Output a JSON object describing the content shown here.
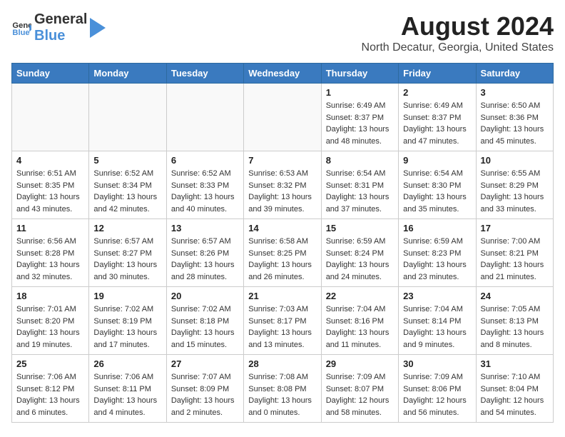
{
  "header": {
    "logo_general": "General",
    "logo_blue": "Blue",
    "title": "August 2024",
    "subtitle": "North Decatur, Georgia, United States"
  },
  "calendar": {
    "weekdays": [
      "Sunday",
      "Monday",
      "Tuesday",
      "Wednesday",
      "Thursday",
      "Friday",
      "Saturday"
    ],
    "weeks": [
      [
        {
          "day": "",
          "info": ""
        },
        {
          "day": "",
          "info": ""
        },
        {
          "day": "",
          "info": ""
        },
        {
          "day": "",
          "info": ""
        },
        {
          "day": "1",
          "info": "Sunrise: 6:49 AM\nSunset: 8:37 PM\nDaylight: 13 hours\nand 48 minutes."
        },
        {
          "day": "2",
          "info": "Sunrise: 6:49 AM\nSunset: 8:37 PM\nDaylight: 13 hours\nand 47 minutes."
        },
        {
          "day": "3",
          "info": "Sunrise: 6:50 AM\nSunset: 8:36 PM\nDaylight: 13 hours\nand 45 minutes."
        }
      ],
      [
        {
          "day": "4",
          "info": "Sunrise: 6:51 AM\nSunset: 8:35 PM\nDaylight: 13 hours\nand 43 minutes."
        },
        {
          "day": "5",
          "info": "Sunrise: 6:52 AM\nSunset: 8:34 PM\nDaylight: 13 hours\nand 42 minutes."
        },
        {
          "day": "6",
          "info": "Sunrise: 6:52 AM\nSunset: 8:33 PM\nDaylight: 13 hours\nand 40 minutes."
        },
        {
          "day": "7",
          "info": "Sunrise: 6:53 AM\nSunset: 8:32 PM\nDaylight: 13 hours\nand 39 minutes."
        },
        {
          "day": "8",
          "info": "Sunrise: 6:54 AM\nSunset: 8:31 PM\nDaylight: 13 hours\nand 37 minutes."
        },
        {
          "day": "9",
          "info": "Sunrise: 6:54 AM\nSunset: 8:30 PM\nDaylight: 13 hours\nand 35 minutes."
        },
        {
          "day": "10",
          "info": "Sunrise: 6:55 AM\nSunset: 8:29 PM\nDaylight: 13 hours\nand 33 minutes."
        }
      ],
      [
        {
          "day": "11",
          "info": "Sunrise: 6:56 AM\nSunset: 8:28 PM\nDaylight: 13 hours\nand 32 minutes."
        },
        {
          "day": "12",
          "info": "Sunrise: 6:57 AM\nSunset: 8:27 PM\nDaylight: 13 hours\nand 30 minutes."
        },
        {
          "day": "13",
          "info": "Sunrise: 6:57 AM\nSunset: 8:26 PM\nDaylight: 13 hours\nand 28 minutes."
        },
        {
          "day": "14",
          "info": "Sunrise: 6:58 AM\nSunset: 8:25 PM\nDaylight: 13 hours\nand 26 minutes."
        },
        {
          "day": "15",
          "info": "Sunrise: 6:59 AM\nSunset: 8:24 PM\nDaylight: 13 hours\nand 24 minutes."
        },
        {
          "day": "16",
          "info": "Sunrise: 6:59 AM\nSunset: 8:23 PM\nDaylight: 13 hours\nand 23 minutes."
        },
        {
          "day": "17",
          "info": "Sunrise: 7:00 AM\nSunset: 8:21 PM\nDaylight: 13 hours\nand 21 minutes."
        }
      ],
      [
        {
          "day": "18",
          "info": "Sunrise: 7:01 AM\nSunset: 8:20 PM\nDaylight: 13 hours\nand 19 minutes."
        },
        {
          "day": "19",
          "info": "Sunrise: 7:02 AM\nSunset: 8:19 PM\nDaylight: 13 hours\nand 17 minutes."
        },
        {
          "day": "20",
          "info": "Sunrise: 7:02 AM\nSunset: 8:18 PM\nDaylight: 13 hours\nand 15 minutes."
        },
        {
          "day": "21",
          "info": "Sunrise: 7:03 AM\nSunset: 8:17 PM\nDaylight: 13 hours\nand 13 minutes."
        },
        {
          "day": "22",
          "info": "Sunrise: 7:04 AM\nSunset: 8:16 PM\nDaylight: 13 hours\nand 11 minutes."
        },
        {
          "day": "23",
          "info": "Sunrise: 7:04 AM\nSunset: 8:14 PM\nDaylight: 13 hours\nand 9 minutes."
        },
        {
          "day": "24",
          "info": "Sunrise: 7:05 AM\nSunset: 8:13 PM\nDaylight: 13 hours\nand 8 minutes."
        }
      ],
      [
        {
          "day": "25",
          "info": "Sunrise: 7:06 AM\nSunset: 8:12 PM\nDaylight: 13 hours\nand 6 minutes."
        },
        {
          "day": "26",
          "info": "Sunrise: 7:06 AM\nSunset: 8:11 PM\nDaylight: 13 hours\nand 4 minutes."
        },
        {
          "day": "27",
          "info": "Sunrise: 7:07 AM\nSunset: 8:09 PM\nDaylight: 13 hours\nand 2 minutes."
        },
        {
          "day": "28",
          "info": "Sunrise: 7:08 AM\nSunset: 8:08 PM\nDaylight: 13 hours\nand 0 minutes."
        },
        {
          "day": "29",
          "info": "Sunrise: 7:09 AM\nSunset: 8:07 PM\nDaylight: 12 hours\nand 58 minutes."
        },
        {
          "day": "30",
          "info": "Sunrise: 7:09 AM\nSunset: 8:06 PM\nDaylight: 12 hours\nand 56 minutes."
        },
        {
          "day": "31",
          "info": "Sunrise: 7:10 AM\nSunset: 8:04 PM\nDaylight: 12 hours\nand 54 minutes."
        }
      ]
    ]
  }
}
